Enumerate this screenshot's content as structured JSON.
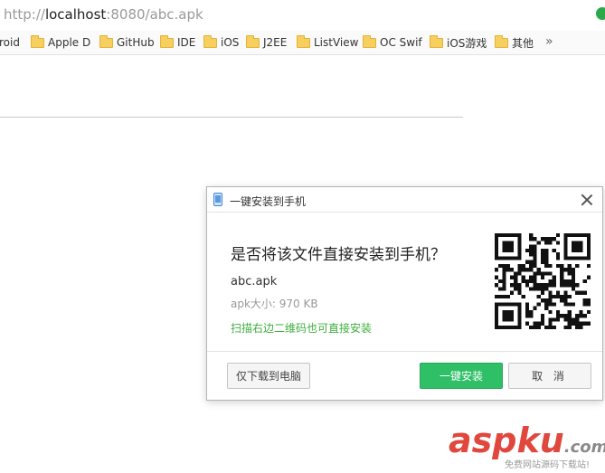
{
  "address_bar": {
    "url_prefix": "http://",
    "url_host": "localhost",
    "url_rest": ":8080/abc.apk"
  },
  "bookmarks": {
    "items": [
      {
        "label": "roid",
        "folder": false
      },
      {
        "label": "Apple D",
        "folder": true
      },
      {
        "label": "GitHub",
        "folder": true
      },
      {
        "label": "IDE",
        "folder": true
      },
      {
        "label": "iOS",
        "folder": true
      },
      {
        "label": "J2EE",
        "folder": true
      },
      {
        "label": "ListView",
        "folder": true
      },
      {
        "label": "OC Swif",
        "folder": true
      },
      {
        "label": "iOS游戏",
        "folder": true
      },
      {
        "label": "其他",
        "folder": true
      }
    ],
    "more": "»"
  },
  "dialog": {
    "title": "一键安装到手机",
    "question": "是否将该文件直接安装到手机？",
    "file_name": "abc.apk",
    "file_size": "apk大小: 970 KB",
    "hint": "扫描右边二维码也可直接安装",
    "download_label": "仅下载到电脑",
    "install_label": "一键安装",
    "cancel_label": "取 消",
    "accent_color": "#2fbf66",
    "hint_color": "#3fae3f"
  },
  "watermark": {
    "asp": "asp",
    "ku": "ku",
    "com": ".com",
    "sub": "免费网站源码下载站!"
  }
}
